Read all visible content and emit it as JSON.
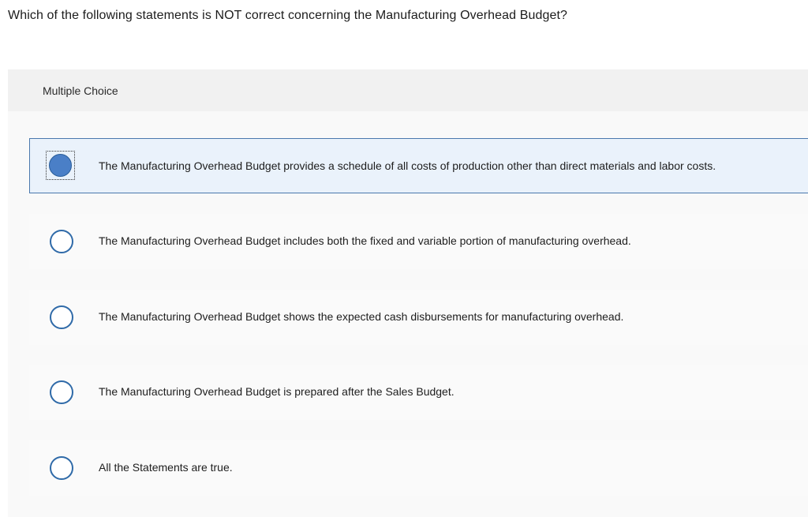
{
  "question": {
    "text": "Which of the following statements is NOT correct concerning the Manufacturing Overhead Budget?"
  },
  "panel": {
    "header_label": "Multiple Choice"
  },
  "choices": [
    {
      "text": "The Manufacturing Overhead Budget provides a schedule of all costs of production other than direct materials and labor costs.",
      "selected": true
    },
    {
      "text": "The Manufacturing Overhead Budget includes both the fixed and variable portion of manufacturing overhead.",
      "selected": false
    },
    {
      "text": "The Manufacturing Overhead Budget shows the expected cash disbursements for manufacturing overhead.",
      "selected": false
    },
    {
      "text": "The Manufacturing Overhead Budget is prepared after the Sales Budget.",
      "selected": false
    },
    {
      "text": "All the Statements are true.",
      "selected": false
    }
  ],
  "colors": {
    "accent": "#2f6aa8",
    "selected_fill": "#4a7fc7",
    "selected_background": "#eaf2fb",
    "selected_border": "#4a78ad"
  }
}
